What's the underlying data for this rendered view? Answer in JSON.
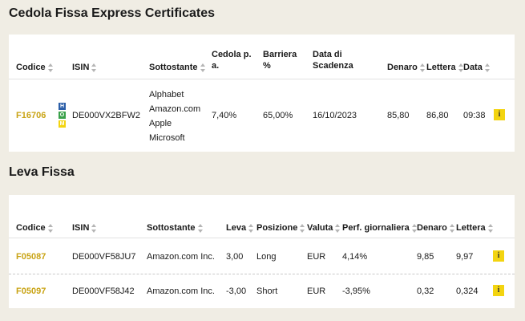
{
  "section1": {
    "title": "Cedola Fissa Express Certificates",
    "headers": {
      "codice": "Codice",
      "isin": "ISIN",
      "sottostante": "Sottostante",
      "cedola_l1": "Cedola p.",
      "cedola_l2": "a.",
      "barriera_l1": "Barriera",
      "barriera_l2": "%",
      "scadenza_l1": "Data di",
      "scadenza_l2": "Scadenza",
      "denaro": "Denaro",
      "lettera": "Lettera",
      "data": "Data"
    },
    "row": {
      "codice": "F16706",
      "badges": [
        {
          "letter": "H",
          "color": "#2b5ea8"
        },
        {
          "letter": "O",
          "color": "#3aa14a"
        },
        {
          "letter": "M",
          "color": "#f3d410"
        }
      ],
      "isin": "DE000VX2BFW2",
      "sottostante": [
        "Alphabet",
        "Amazon.com",
        "Apple",
        "Microsoft"
      ],
      "cedola": "7,40%",
      "barriera": "65,00%",
      "scadenza": "16/10/2023",
      "denaro": "85,80",
      "lettera": "86,80",
      "data": "09:38",
      "info": "i"
    }
  },
  "section2": {
    "title": "Leva Fissa",
    "headers": {
      "codice": "Codice",
      "isin": "ISIN",
      "sottostante": "Sottostante",
      "leva": "Leva",
      "posizione": "Posizione",
      "valuta": "Valuta",
      "perf": "Perf. giornaliera",
      "denaro": "Denaro",
      "lettera": "Lettera"
    },
    "rows": [
      {
        "codice": "F05087",
        "isin": "DE000VF58JU7",
        "sottostante": "Amazon.com Inc.",
        "leva": "3,00",
        "posizione": "Long",
        "valuta": "EUR",
        "perf": "4,14%",
        "denaro": "9,85",
        "lettera": "9,97",
        "info": "i"
      },
      {
        "codice": "F05097",
        "isin": "DE000VF58J42",
        "sottostante": "Amazon.com Inc.",
        "leva": "-3,00",
        "posizione": "Short",
        "valuta": "EUR",
        "perf": "-3,95%",
        "denaro": "0,32",
        "lettera": "0,324",
        "info": "i"
      }
    ]
  }
}
